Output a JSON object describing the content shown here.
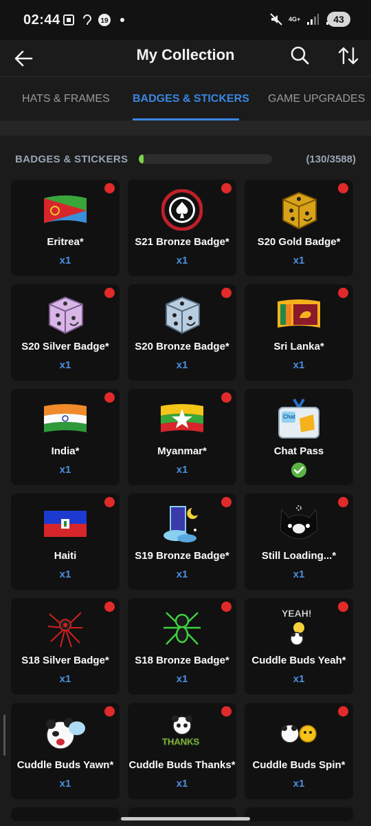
{
  "status_bar": {
    "time": "02:44",
    "network": "4G+",
    "battery": "43"
  },
  "header": {
    "title": "My Collection"
  },
  "tabs": [
    {
      "label": "HATS & FRAMES"
    },
    {
      "label": "BADGES & STICKERS"
    },
    {
      "label": "GAME UPGRADES"
    }
  ],
  "section": {
    "title": "BADGES & STICKERS",
    "count": "(130/3588)",
    "progress_fraction": 0.036
  },
  "colors": {
    "accent": "#3a86e0",
    "new_dot": "#e12a2a",
    "progress": "#7ed348",
    "owned_check": "#5bb346"
  },
  "items": [
    {
      "name": "Eritrea*",
      "qty": "x1",
      "icon": "eritrea-flag-icon",
      "new": true
    },
    {
      "name": "S21 Bronze Badge*",
      "qty": "x1",
      "icon": "casino-chip-icon",
      "new": true
    },
    {
      "name": "S20 Gold Badge*",
      "qty": "x1",
      "icon": "gold-dice-icon",
      "new": true
    },
    {
      "name": "S20 Silver Badge*",
      "qty": "x1",
      "icon": "silver-dice-icon",
      "new": true
    },
    {
      "name": "S20 Bronze Badge*",
      "qty": "x1",
      "icon": "bronze-dice-icon",
      "new": true
    },
    {
      "name": "Sri Lanka*",
      "qty": "x1",
      "icon": "sri-lanka-flag-icon",
      "new": true
    },
    {
      "name": "India*",
      "qty": "x1",
      "icon": "india-flag-icon",
      "new": true
    },
    {
      "name": "Myanmar*",
      "qty": "x1",
      "icon": "myanmar-flag-icon",
      "new": true
    },
    {
      "name": "Chat Pass",
      "qty": "",
      "icon": "chat-pass-icon",
      "new": false,
      "owned": true
    },
    {
      "name": "Haiti",
      "qty": "x1",
      "icon": "haiti-flag-icon",
      "new": true
    },
    {
      "name": "S19 Bronze Badge*",
      "qty": "x1",
      "icon": "moon-door-icon",
      "new": true
    },
    {
      "name": "Still Loading...*",
      "qty": "x1",
      "icon": "loading-cat-icon",
      "new": true
    },
    {
      "name": "S18 Silver Badge*",
      "qty": "x1",
      "icon": "red-spider-icon",
      "new": true
    },
    {
      "name": "S18 Bronze Badge*",
      "qty": "x1",
      "icon": "green-spider-icon",
      "new": true
    },
    {
      "name": "Cuddle Buds Yeah*",
      "qty": "x1",
      "icon": "cuddle-buds-yeah-icon",
      "new": true
    },
    {
      "name": "Cuddle Buds Yawn*",
      "qty": "x1",
      "icon": "panda-yawn-icon",
      "new": true
    },
    {
      "name": "Cuddle Buds Thanks*",
      "qty": "x1",
      "icon": "panda-thanks-icon",
      "new": true
    },
    {
      "name": "Cuddle Buds Spin*",
      "qty": "x1",
      "icon": "panda-spin-icon",
      "new": true
    }
  ]
}
